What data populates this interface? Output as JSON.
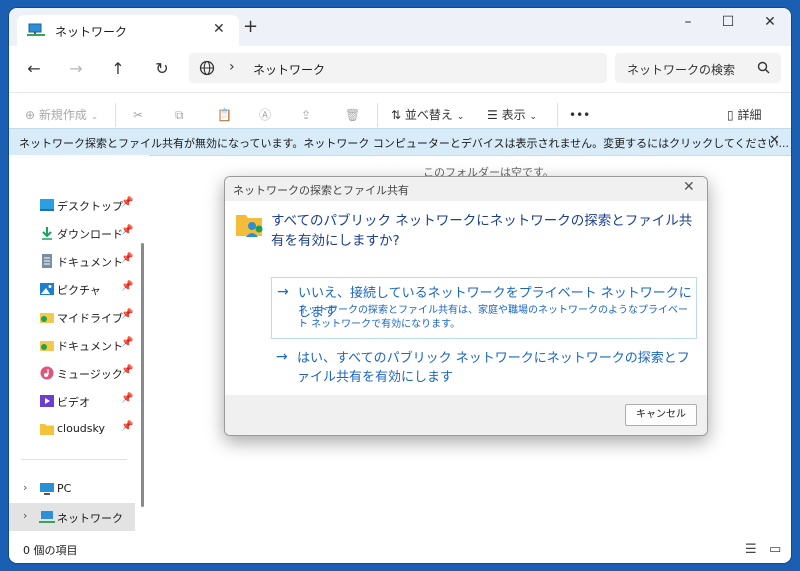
{
  "window": {
    "tab_title": "ネットワーク",
    "new_tab": "+",
    "controls": [
      "–",
      "☐",
      "✕"
    ]
  },
  "address": {
    "path": "ネットワーク",
    "search_placeholder": "ネットワークの検索"
  },
  "toolbar": {
    "new_label": "新規作成",
    "sort_label": "並べ替え",
    "view_label": "表示",
    "more_label": "•••",
    "details_label": "詳細"
  },
  "infobar": {
    "text": "ネットワーク探索とファイル共有が無効になっています。ネットワーク コンピューターとデバイスは表示されません。変更するにはクリックしてください..."
  },
  "sidebar": {
    "items": [
      {
        "label": "デスクトップ",
        "icon": "desktop-icon"
      },
      {
        "label": "ダウンロード",
        "icon": "download-icon"
      },
      {
        "label": "ドキュメント",
        "icon": "document-icon"
      },
      {
        "label": "ピクチャ",
        "icon": "picture-icon"
      },
      {
        "label": "マイドライブ",
        "icon": "drive-icon"
      },
      {
        "label": "ドキュメント",
        "icon": "drive-document-icon"
      },
      {
        "label": "ミュージック",
        "icon": "music-icon"
      },
      {
        "label": "ビデオ",
        "icon": "video-icon"
      },
      {
        "label": "cloudsky",
        "icon": "folder-icon"
      }
    ],
    "pc_label": "PC",
    "network_label": "ネットワーク"
  },
  "content": {
    "empty_text": "このフォルダーは空です。"
  },
  "status": {
    "item_count": "0 個の項目"
  },
  "dialog": {
    "title": "ネットワークの探索とファイル共有",
    "question": "すべてのパブリック ネットワークにネットワークの探索とファイル共有を有効にしますか?",
    "option1_title": "いいえ、接続しているネットワークをプライベート ネットワークにします",
    "option1_desc": "ネットワークの探索とファイル共有は、家庭や職場のネットワークのようなプライベート ネットワークで有効になります。",
    "option2_title": "はい、すべてのパブリック ネットワークにネットワークの探索とファイル共有を有効にします",
    "cancel_label": "キャンセル"
  },
  "colors": {
    "accent": "#1a66c4",
    "infobar": "#d7ebf9",
    "desktop": "#1b5fb3"
  }
}
